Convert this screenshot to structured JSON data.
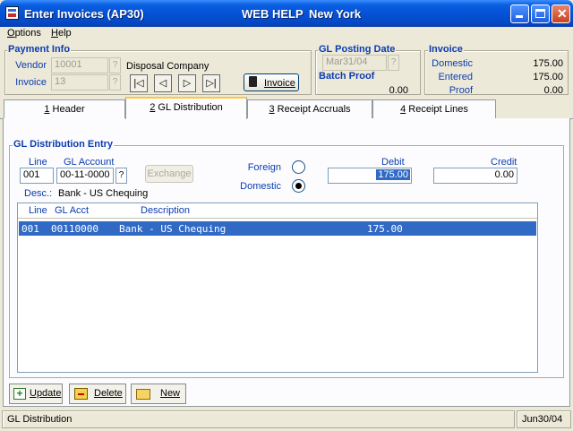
{
  "window": {
    "title": "Enter Invoices (AP30)",
    "help_link": "WEB HELP",
    "location": "New York"
  },
  "menu": {
    "options": "Options",
    "help": "Help"
  },
  "payment_info": {
    "title": "Payment Info",
    "vendor_label": "Vendor",
    "vendor_value": "10001",
    "vendor_name": "Disposal Company",
    "invoice_label": "Invoice",
    "invoice_value": "13",
    "invoice_button": "Invoice"
  },
  "gl_posting": {
    "title": "GL Posting Date",
    "date_value": "Mar31/04",
    "batch_proof_label": "Batch Proof",
    "batch_proof_value": "0.00"
  },
  "invoice_summary": {
    "title": "Invoice",
    "domestic_label": "Domestic",
    "domestic_value": "175.00",
    "entered_label": "Entered",
    "entered_value": "175.00",
    "proof_label": "Proof",
    "proof_value": "0.00"
  },
  "tabs": [
    {
      "num": "1",
      "label": " Header"
    },
    {
      "num": "2",
      "label": " GL Distribution"
    },
    {
      "num": "3",
      "label": " Receipt Accruals"
    },
    {
      "num": "4",
      "label": " Receipt Lines"
    }
  ],
  "gl_entry": {
    "title": "GL Distribution Entry",
    "line_label": "Line",
    "line_value": "001",
    "account_label": "GL Account",
    "account_value": "00-11-0000",
    "exchange_button": "Exchange",
    "desc_label": "Desc.:",
    "desc_value": "Bank - US Chequing",
    "foreign_label": "Foreign",
    "domestic_label": "Domestic",
    "debit_label": "Debit",
    "debit_value": "175.00",
    "credit_label": "Credit",
    "credit_value": "0.00"
  },
  "list": {
    "columns": [
      "Line",
      "GL Acct",
      "Description"
    ],
    "rows": [
      {
        "line": "001",
        "acct": "00110000",
        "description": "Bank - US Chequing",
        "amount": "175.00"
      }
    ]
  },
  "actions": {
    "update": "Update",
    "delete": "Delete",
    "new": "New"
  },
  "status": {
    "left": "GL Distribution",
    "right": "Jun30/04"
  },
  "colors": {
    "accent": "#0b3cb0",
    "titlebar": "#0552d6",
    "selection": "#316ac5"
  }
}
